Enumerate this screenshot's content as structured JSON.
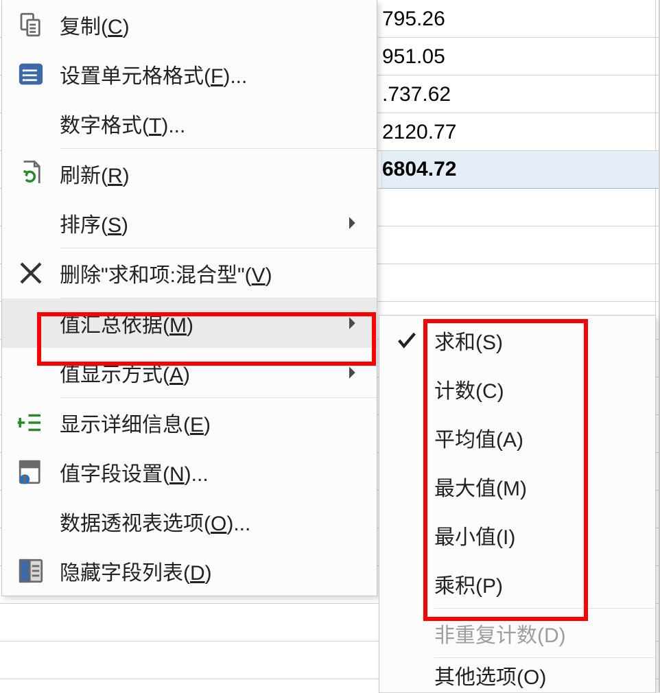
{
  "bg_values": {
    "rows": [
      {
        "val": "795.26"
      },
      {
        "val": "951.05"
      },
      {
        "val": ".737.62"
      },
      {
        "val": "2120.77"
      },
      {
        "val": "6804.72",
        "total": true
      }
    ]
  },
  "menu": {
    "copy": {
      "pre": "复制(",
      "u": "C",
      "post": ")"
    },
    "formatCells": {
      "pre": "设置单元格格式(",
      "u": "F",
      "post": ")..."
    },
    "numberFormat": {
      "pre": "数字格式(",
      "u": "T",
      "post": ")..."
    },
    "refresh": {
      "pre": "刷新(",
      "u": "R",
      "post": ")"
    },
    "sort": {
      "pre": "排序(",
      "u": "S",
      "post": ")"
    },
    "remove": {
      "pre": "删除\"求和项:混合型\"(",
      "u": "V",
      "post": ")"
    },
    "summarizeBy": {
      "pre": "值汇总依据(",
      "u": "M",
      "post": ")"
    },
    "showValuesAs": {
      "pre": "值显示方式(",
      "u": "A",
      "post": ")"
    },
    "showDetails": {
      "pre": "显示详细信息(",
      "u": "E",
      "post": ")"
    },
    "fieldSettings": {
      "pre": "值字段设置(",
      "u": "N",
      "post": ")..."
    },
    "pivotOptions": {
      "pre": "数据透视表选项(",
      "u": "O",
      "post": ")..."
    },
    "hideFieldList": {
      "pre": "隐藏字段列表(",
      "u": "D",
      "post": ")"
    }
  },
  "submenu": {
    "sum": {
      "pre": "求和(",
      "u": "S",
      "post": ")",
      "checked": true
    },
    "count": {
      "pre": "计数(",
      "u": "C",
      "post": ")"
    },
    "average": {
      "pre": "平均值(",
      "u": "A",
      "post": ")"
    },
    "max": {
      "pre": "最大值(",
      "u": "M",
      "post": ")"
    },
    "min": {
      "pre": "最小值(",
      "u": "I",
      "post": ")"
    },
    "product": {
      "pre": "乘积(",
      "u": "P",
      "post": ")"
    },
    "distinctCount": {
      "pre": "非重复计数(",
      "u": "D",
      "post": ")",
      "disabled": true
    },
    "moreOptions": {
      "pre": "其他选项(",
      "u": "O",
      "post": ")"
    }
  }
}
